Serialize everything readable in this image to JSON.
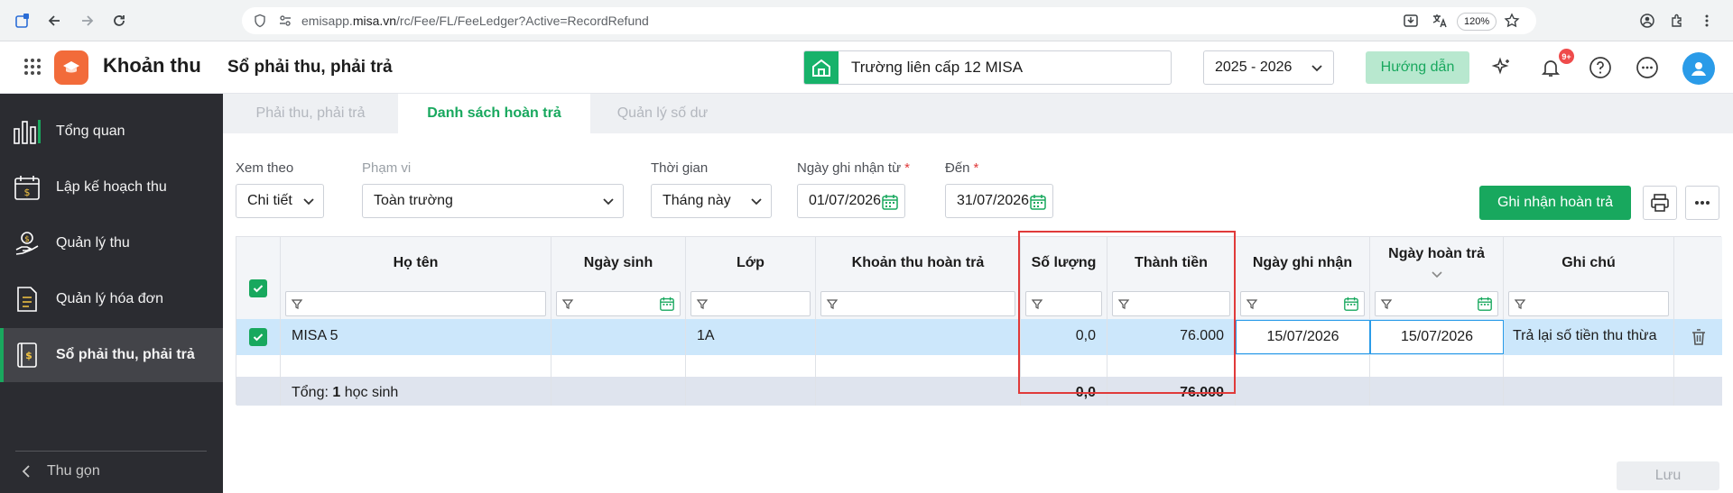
{
  "browser": {
    "url_host": "emisapp.misa.vn",
    "url_path": "/rc/Fee/FL/FeeLedger?Active=RecordRefund",
    "url_prefix": "emisapp.",
    "url_host_main": "misa.vn",
    "zoom": "120%"
  },
  "header": {
    "app_name": "Khoản thu",
    "page_title": "Sổ phải thu, phải trả",
    "school": "Trường liên cấp 12 MISA",
    "year": "2025 - 2026",
    "guide_label": "Hướng dẫn",
    "notif_badge": "9+"
  },
  "sidebar": {
    "items": [
      {
        "label": "Tổng quan",
        "icon": "chart-bars-icon"
      },
      {
        "label": "Lập kế hoạch thu",
        "icon": "calendar-money-icon"
      },
      {
        "label": "Quản lý thu",
        "icon": "hand-coin-icon"
      },
      {
        "label": "Quản lý hóa đơn",
        "icon": "invoice-icon"
      },
      {
        "label": "Sổ phải thu, phải trả",
        "icon": "ledger-book-icon"
      }
    ],
    "collapse_label": "Thu gọn"
  },
  "tabs": [
    "Phải thu, phải trả",
    "Danh sách hoàn trả",
    "Quản lý số dư"
  ],
  "filters": {
    "view_by": {
      "label": "Xem theo",
      "value": "Chi tiết"
    },
    "scope": {
      "label": "Phạm vi",
      "value": "Toàn trường"
    },
    "period": {
      "label": "Thời gian",
      "value": "Tháng này"
    },
    "from": {
      "label": "Ngày ghi nhận từ",
      "value": "01/07/2026"
    },
    "to": {
      "label": "Đến",
      "value": "31/07/2026"
    }
  },
  "actions": {
    "record_refund": "Ghi nhận hoàn trả",
    "save": "Lưu"
  },
  "table": {
    "columns": [
      "Họ tên",
      "Ngày sinh",
      "Lớp",
      "Khoản thu hoàn trả",
      "Số lượng",
      "Thành tiền",
      "Ngày ghi nhận",
      "Ngày hoàn trả",
      "Ghi chú"
    ],
    "row": {
      "name": "MISA 5",
      "dob": "",
      "class": "1A",
      "fee": "",
      "qty": "0,0",
      "amount": "76.000",
      "record_date": "15/07/2026",
      "refund_date": "15/07/2026",
      "note": "Trả lại số tiền thu thừa"
    },
    "total": {
      "prefix": "Tổng: ",
      "count": "1",
      "suffix": " học sinh",
      "qty": "0,0",
      "amount": "76.000"
    }
  },
  "colors": {
    "brand_green": "#18a85e",
    "sidebar_bg": "#2b2c31",
    "highlight_red": "#e03a3a",
    "row_selected": "#cce7fb"
  }
}
